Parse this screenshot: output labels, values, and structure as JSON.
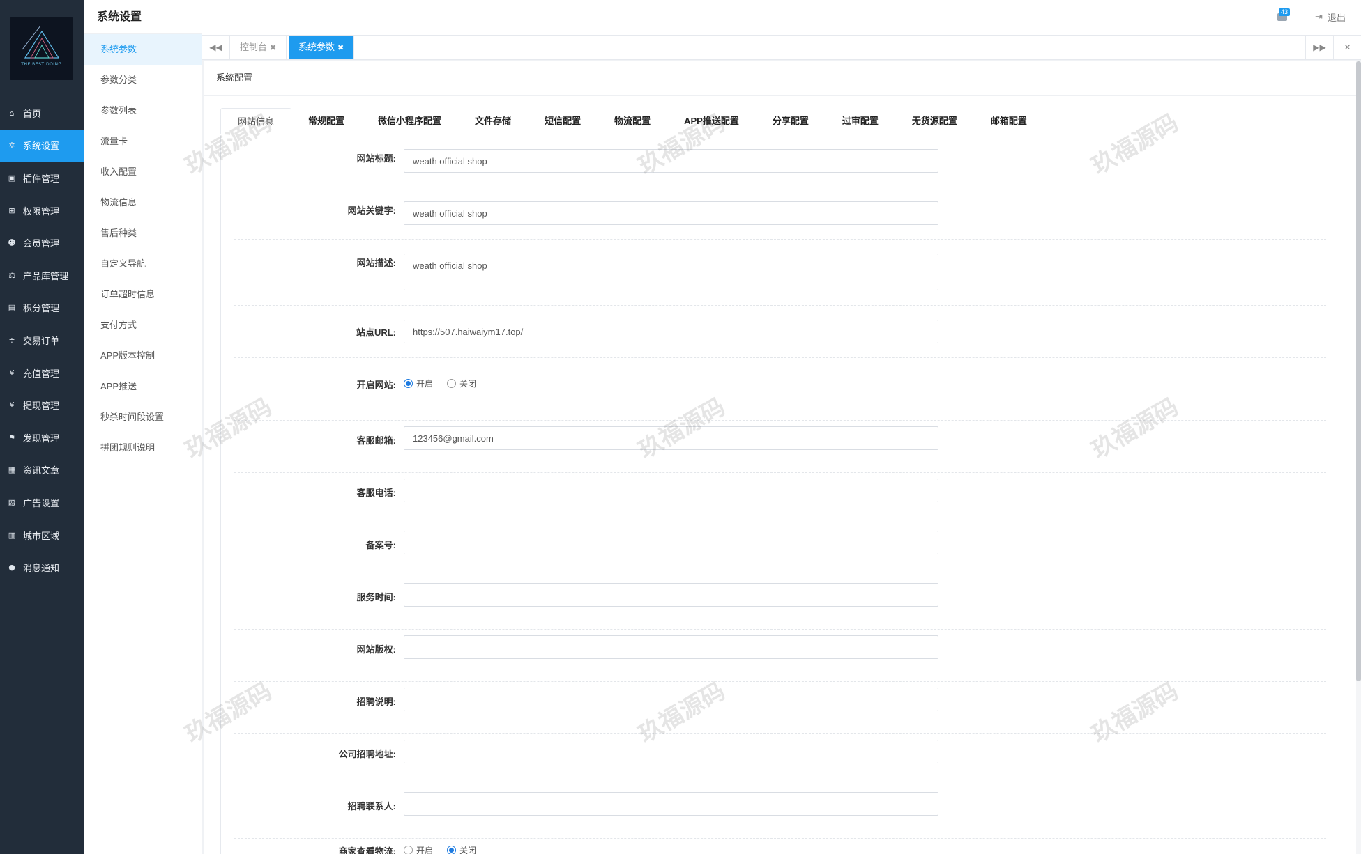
{
  "sidebar": {
    "logo_text": "THE BEST DOING",
    "items": [
      {
        "label": "首页",
        "icon": "home-icon",
        "glyph": "⌂"
      },
      {
        "label": "系统设置",
        "icon": "gear-icon",
        "glyph": "✲",
        "active": true
      },
      {
        "label": "插件管理",
        "icon": "plugin-icon",
        "glyph": "▣"
      },
      {
        "label": "权限管理",
        "icon": "sitemap-icon",
        "glyph": "⊞"
      },
      {
        "label": "会员管理",
        "icon": "users-icon",
        "glyph": "☻"
      },
      {
        "label": "产品库管理",
        "icon": "scale-icon",
        "glyph": "⚖"
      },
      {
        "label": "积分管理",
        "icon": "document-icon",
        "glyph": "▤"
      },
      {
        "label": "交易订单",
        "icon": "order-icon",
        "glyph": "≑"
      },
      {
        "label": "充值管理",
        "icon": "yen-icon",
        "glyph": "¥"
      },
      {
        "label": "提现管理",
        "icon": "yen-icon",
        "glyph": "¥"
      },
      {
        "label": "发现管理",
        "icon": "flag-icon",
        "glyph": "⚑"
      },
      {
        "label": "资讯文章",
        "icon": "newspaper-icon",
        "glyph": "▦"
      },
      {
        "label": "广告设置",
        "icon": "image-icon",
        "glyph": "▨"
      },
      {
        "label": "城市区域",
        "icon": "map-icon",
        "glyph": "▥"
      },
      {
        "label": "消息通知",
        "icon": "comment-icon",
        "glyph": "●"
      }
    ]
  },
  "submenu": {
    "title": "系统设置",
    "items": [
      "系统参数",
      "参数分类",
      "参数列表",
      "流量卡",
      "收入配置",
      "物流信息",
      "售后种类",
      "自定义导航",
      "订单超时信息",
      "支付方式",
      "APP版本控制",
      "APP推送",
      "秒杀时间段设置",
      "拼团规则说明"
    ]
  },
  "header": {
    "message_count": "43",
    "logout_label": "退出"
  },
  "page_tabs": [
    {
      "label": "控制台"
    },
    {
      "label": "系统参数",
      "active": true
    }
  ],
  "panel": {
    "title": "系统配置",
    "tabs": [
      "网站信息",
      "常规配置",
      "微信小程序配置",
      "文件存储",
      "短信配置",
      "物流配置",
      "APP推送配置",
      "分享配置",
      "过审配置",
      "无货源配置",
      "邮箱配置"
    ]
  },
  "form": {
    "site_title": {
      "label": "网站标题:",
      "value": "weath official shop"
    },
    "site_keywords": {
      "label": "网站关键字:",
      "value": "weath official shop"
    },
    "site_description": {
      "label": "网站描述:",
      "value": "weath official shop"
    },
    "site_url": {
      "label": "站点URL:",
      "value": "https://507.haiwaiym17.top/"
    },
    "site_open": {
      "label": "开启网站:",
      "on_label": "开启",
      "off_label": "关闭",
      "value": "开启"
    },
    "service_email": {
      "label": "客服邮箱:",
      "value": "123456@gmail.com"
    },
    "service_phone": {
      "label": "客服电话:",
      "value": ""
    },
    "icp_number": {
      "label": "备案号:",
      "value": ""
    },
    "service_hours": {
      "label": "服务时间:",
      "value": ""
    },
    "copyright": {
      "label": "网站版权:",
      "value": ""
    },
    "recruit_desc": {
      "label": "招聘说明:",
      "value": ""
    },
    "recruit_address": {
      "label": "公司招聘地址:",
      "value": ""
    },
    "recruit_contact": {
      "label": "招聘联系人:",
      "value": ""
    },
    "merchant_logistics": {
      "label": "商家查看物流:",
      "on_label": "开启",
      "off_label": "关闭",
      "value": "关闭"
    }
  },
  "watermark_text": "玖福源码",
  "colors": {
    "sidebar_bg": "#222d3a",
    "accent": "#1e9bef"
  }
}
